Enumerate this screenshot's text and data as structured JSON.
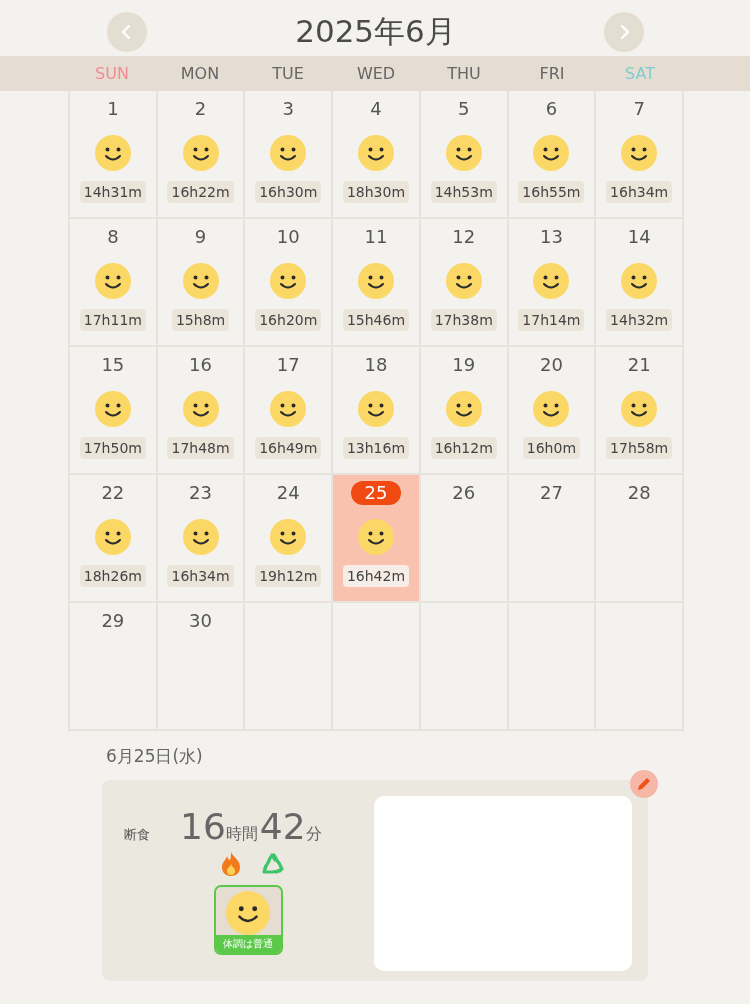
{
  "header": {
    "title": "2025年6月"
  },
  "weekdays": [
    {
      "label": "SUN",
      "color": "#f08c94"
    },
    {
      "label": "MON",
      "color": "#666666"
    },
    {
      "label": "TUE",
      "color": "#666666"
    },
    {
      "label": "WED",
      "color": "#666666"
    },
    {
      "label": "THU",
      "color": "#666666"
    },
    {
      "label": "FRI",
      "color": "#666666"
    },
    {
      "label": "SAT",
      "color": "#7fcdd0"
    }
  ],
  "days": [
    {
      "day": "1",
      "fast": "14h31m",
      "selected": false
    },
    {
      "day": "2",
      "fast": "16h22m",
      "selected": false
    },
    {
      "day": "3",
      "fast": "16h30m",
      "selected": false
    },
    {
      "day": "4",
      "fast": "18h30m",
      "selected": false
    },
    {
      "day": "5",
      "fast": "14h53m",
      "selected": false
    },
    {
      "day": "6",
      "fast": "16h55m",
      "selected": false
    },
    {
      "day": "7",
      "fast": "16h34m",
      "selected": false
    },
    {
      "day": "8",
      "fast": "17h11m",
      "selected": false
    },
    {
      "day": "9",
      "fast": "15h8m",
      "selected": false
    },
    {
      "day": "10",
      "fast": "16h20m",
      "selected": false
    },
    {
      "day": "11",
      "fast": "15h46m",
      "selected": false
    },
    {
      "day": "12",
      "fast": "17h38m",
      "selected": false
    },
    {
      "day": "13",
      "fast": "17h14m",
      "selected": false
    },
    {
      "day": "14",
      "fast": "14h32m",
      "selected": false
    },
    {
      "day": "15",
      "fast": "17h50m",
      "selected": false
    },
    {
      "day": "16",
      "fast": "17h48m",
      "selected": false
    },
    {
      "day": "17",
      "fast": "16h49m",
      "selected": false
    },
    {
      "day": "18",
      "fast": "13h16m",
      "selected": false
    },
    {
      "day": "19",
      "fast": "16h12m",
      "selected": false
    },
    {
      "day": "20",
      "fast": "16h0m",
      "selected": false
    },
    {
      "day": "21",
      "fast": "17h58m",
      "selected": false
    },
    {
      "day": "22",
      "fast": "18h26m",
      "selected": false
    },
    {
      "day": "23",
      "fast": "16h34m",
      "selected": false
    },
    {
      "day": "24",
      "fast": "19h12m",
      "selected": false
    },
    {
      "day": "25",
      "fast": "16h42m",
      "selected": true
    },
    {
      "day": "26",
      "selected": false
    },
    {
      "day": "27",
      "selected": false
    },
    {
      "day": "28",
      "selected": false
    },
    {
      "day": "29",
      "selected": false
    },
    {
      "day": "30",
      "selected": false
    }
  ],
  "detail": {
    "date": "6月25日(水)",
    "label": "断食",
    "hours": "16",
    "hours_unit": "時間",
    "minutes": "42",
    "minutes_unit": "分",
    "condition": "体調は普通"
  }
}
